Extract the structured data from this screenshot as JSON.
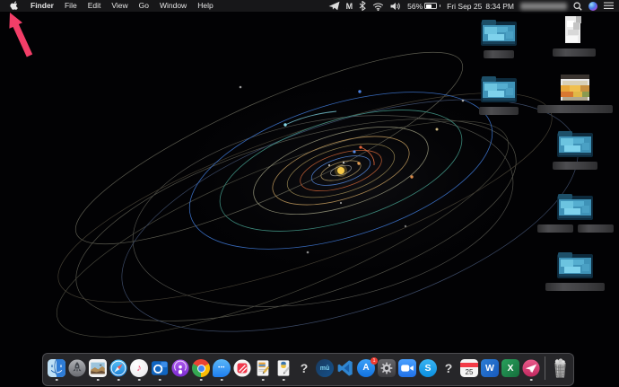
{
  "system": {
    "os": "macOS",
    "theme": "dark"
  },
  "menubar": {
    "app_menu": "Finder",
    "items": [
      "File",
      "Edit",
      "View",
      "Go",
      "Window",
      "Help"
    ],
    "status": {
      "gmail_glyph": "M",
      "battery_percent": "56%",
      "date": "Fri Sep 25",
      "time": "8:34 PM",
      "username_redacted": true
    }
  },
  "annotation": {
    "type": "arrow",
    "color": "#f23e68",
    "points_at": "apple-menu"
  },
  "wallpaper": {
    "description": "solar system orbit diagram on black",
    "sun_color": "#f7c948"
  },
  "desktop_icons": [
    {
      "type": "folder",
      "label": "",
      "label_redacted": true
    },
    {
      "type": "folder",
      "label": "",
      "label_redacted": true
    },
    {
      "type": "document",
      "label": "",
      "label_redacted": true
    },
    {
      "type": "spreadsheet-file",
      "label": "",
      "label_redacted": true
    },
    {
      "type": "folder",
      "label": "",
      "label_redacted": true
    },
    {
      "type": "folder",
      "label": "",
      "label_redacted": true
    },
    {
      "type": "folder",
      "label": "",
      "label_redacted": true
    }
  ],
  "dock": {
    "apps": [
      "Finder",
      "Launchpad",
      "Preview",
      "Safari",
      "Music",
      "Outlook",
      "Podcasts",
      "Chrome",
      "Messages",
      "News",
      "TextEdit Document",
      "Python Document",
      "Unknown App",
      "MuseScore",
      "Visual Studio Code",
      "App Store",
      "System Preferences",
      "Zoom",
      "Skype",
      "Unknown App",
      "Calendar",
      "Word",
      "Excel",
      "Mail"
    ],
    "glyphs": {
      "music_note": "♪",
      "messages_dots": "•••",
      "question": "?",
      "musescore": "mû",
      "appstore": "A",
      "appstore_badge": "1",
      "skype": "S",
      "calendar_day": "25",
      "word": "W",
      "excel": "X"
    },
    "trash": "Trash"
  }
}
